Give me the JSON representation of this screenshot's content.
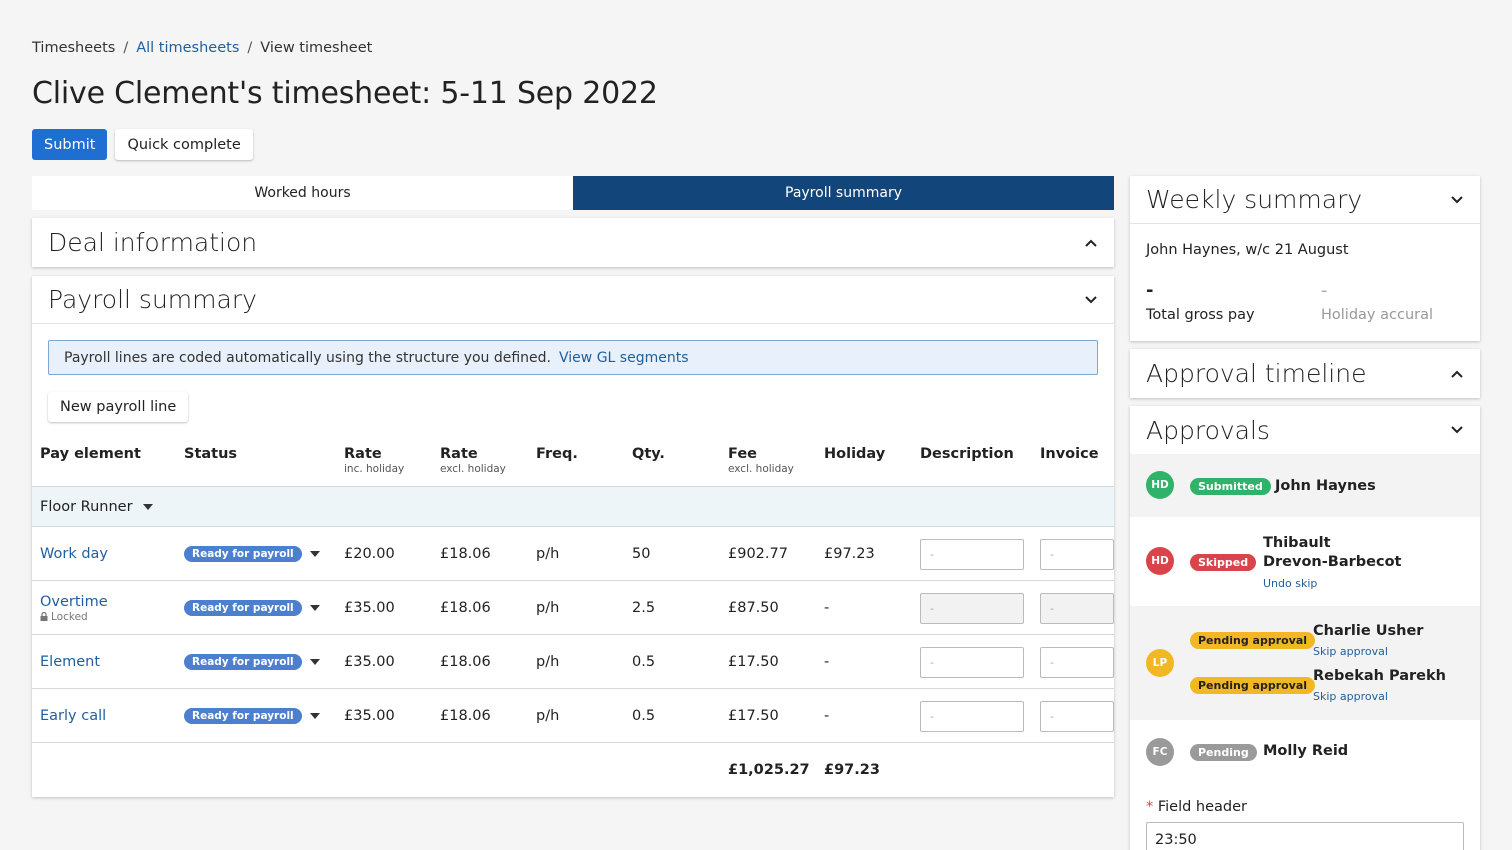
{
  "breadcrumb": {
    "items": [
      "Timesheets",
      "All timesheets",
      "View timesheet"
    ],
    "sep": "/"
  },
  "page": {
    "title": "Clive Clement's timesheet: 5-11 Sep 2022"
  },
  "actions": {
    "submit": "Submit",
    "quick_complete": "Quick complete"
  },
  "tabs": [
    {
      "label": "Worked hours",
      "active": false
    },
    {
      "label": "Payroll summary",
      "active": true
    }
  ],
  "deal": {
    "title": "Deal information"
  },
  "payroll": {
    "title": "Payroll summary",
    "banner_text": "Payroll lines are coded automatically using the structure you defined.",
    "banner_link": "View GL segments",
    "new_line": "New payroll line",
    "columns": {
      "pay_element": "Pay element",
      "status": "Status",
      "rate_inc": "Rate",
      "rate_inc_sub": "inc. holiday",
      "rate_excl": "Rate",
      "rate_excl_sub": "excl. holiday",
      "freq": "Freq.",
      "qty": "Qty.",
      "fee": "Fee",
      "fee_sub": "excl. holiday",
      "holiday": "Holiday",
      "description": "Description",
      "invoice": "Invoice"
    },
    "group": "Floor Runner",
    "rows": [
      {
        "element": "Work day",
        "locked": "",
        "status": "Ready for payroll",
        "rate_inc": "£20.00",
        "rate_excl": "£18.06",
        "freq": "p/h",
        "qty": "50",
        "fee": "£902.77",
        "holiday": "£97.23",
        "desc": "-",
        "invoice": "-"
      },
      {
        "element": "Overtime",
        "locked": "Locked",
        "status": "Ready for payroll",
        "rate_inc": "£35.00",
        "rate_excl": "£18.06",
        "freq": "p/h",
        "qty": "2.5",
        "fee": "£87.50",
        "holiday": "-",
        "desc": "-",
        "invoice": "-"
      },
      {
        "element": "Element",
        "locked": "",
        "status": "Ready for payroll",
        "rate_inc": "£35.00",
        "rate_excl": "£18.06",
        "freq": "p/h",
        "qty": "0.5",
        "fee": "£17.50",
        "holiday": "-",
        "desc": "-",
        "invoice": "-"
      },
      {
        "element": "Early call",
        "locked": "",
        "status": "Ready for payroll",
        "rate_inc": "£35.00",
        "rate_excl": "£18.06",
        "freq": "p/h",
        "qty": "0.5",
        "fee": "£17.50",
        "holiday": "-",
        "desc": "-",
        "invoice": "-"
      }
    ],
    "totals": {
      "fee": "£1,025.27",
      "holiday": "£97.23"
    }
  },
  "weekly": {
    "title": "Weekly summary",
    "subtitle": "John Haynes, w/c 21 August",
    "gross_value": "-",
    "gross_label": "Total gross pay",
    "holiday_value": "-",
    "holiday_label": "Holiday accural"
  },
  "approval_timeline": {
    "title": "Approval timeline"
  },
  "approvals": {
    "title": "Approvals",
    "entries": [
      {
        "initials": "HD",
        "status": "Submitted",
        "name": "John Haynes"
      },
      {
        "initials": "HD",
        "status": "Skipped",
        "name_line1": "Thibault",
        "name_line2": "Drevon-Barbecot",
        "link": "Undo skip"
      },
      {
        "initials": "LP",
        "status1": "Pending approval",
        "name1": "Charlie Usher",
        "link1": "Skip approval",
        "status2": "Pending approval",
        "name2": "Rebekah Parekh",
        "link2": "Skip approval"
      },
      {
        "initials": "FC",
        "status": "Pending",
        "name": "Molly Reid"
      }
    ],
    "field_required": "*",
    "field_label": "Field header",
    "field_value": "23:50"
  },
  "colors": {
    "primary": "#1e6fd1",
    "tab_active": "#12457a",
    "link": "#1f5f9e",
    "ready": "#4d7fcf",
    "submitted": "#2fb36b",
    "skipped": "#d9434a",
    "pending_approval": "#f2b824",
    "pending": "#9a9a9a"
  }
}
